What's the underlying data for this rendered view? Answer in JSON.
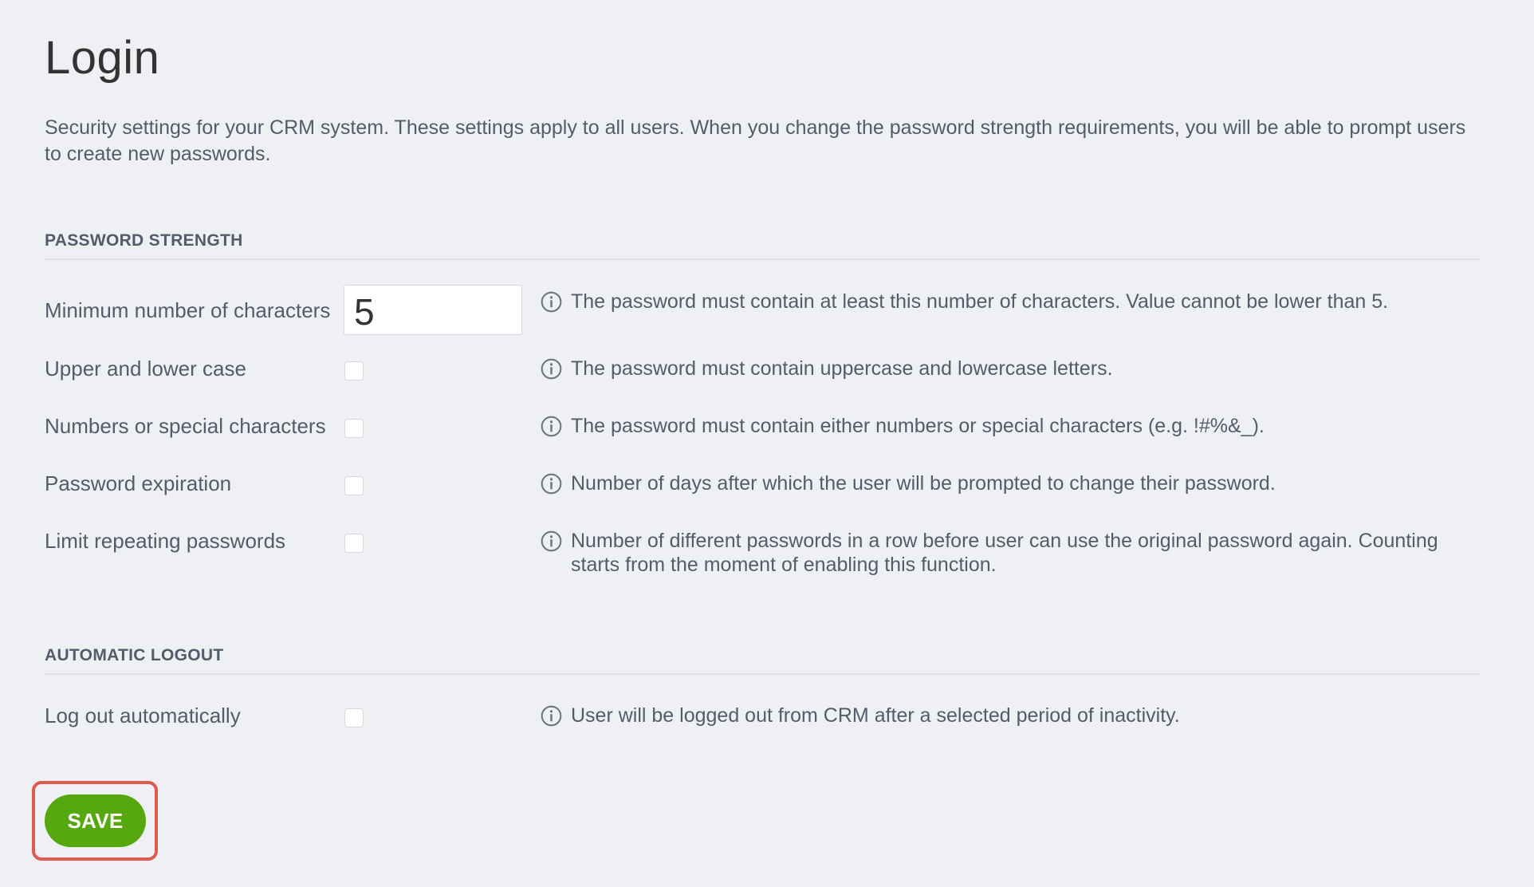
{
  "page": {
    "title": "Login",
    "description": "Security settings for your CRM system. These settings apply to all users. When you change the password strength requirements, you will be able to prompt users to create new passwords."
  },
  "sections": {
    "password_strength": {
      "title": "PASSWORD STRENGTH",
      "rows": [
        {
          "label": "Minimum number of characters",
          "control": "input",
          "value": "5",
          "hint": "The password must contain at least this number of characters. Value cannot be lower than 5."
        },
        {
          "label": "Upper and lower case",
          "control": "checkbox",
          "checked": false,
          "hint": "The password must contain uppercase and lowercase letters."
        },
        {
          "label": "Numbers or special characters",
          "control": "checkbox",
          "checked": false,
          "hint": "The password must contain either numbers or special characters (e.g. !#%&_)."
        },
        {
          "label": "Password expiration",
          "control": "checkbox",
          "checked": false,
          "hint": "Number of days after which the user will be prompted to change their password."
        },
        {
          "label": "Limit repeating passwords",
          "control": "checkbox",
          "checked": false,
          "hint": "Number of different passwords in a row before user can use the original password again. Counting starts from the moment of enabling this function."
        }
      ]
    },
    "automatic_logout": {
      "title": "AUTOMATIC LOGOUT",
      "rows": [
        {
          "label": "Log out automatically",
          "control": "checkbox",
          "checked": false,
          "hint": "User will be logged out from CRM after a selected period of inactivity."
        }
      ]
    }
  },
  "actions": {
    "save_label": "SAVE"
  },
  "icons": {
    "hint": "info-icon"
  },
  "colors": {
    "background": "#eff0f4",
    "text": "#535c69",
    "save_button": "#57a70f",
    "highlight": "#e25a4e"
  }
}
